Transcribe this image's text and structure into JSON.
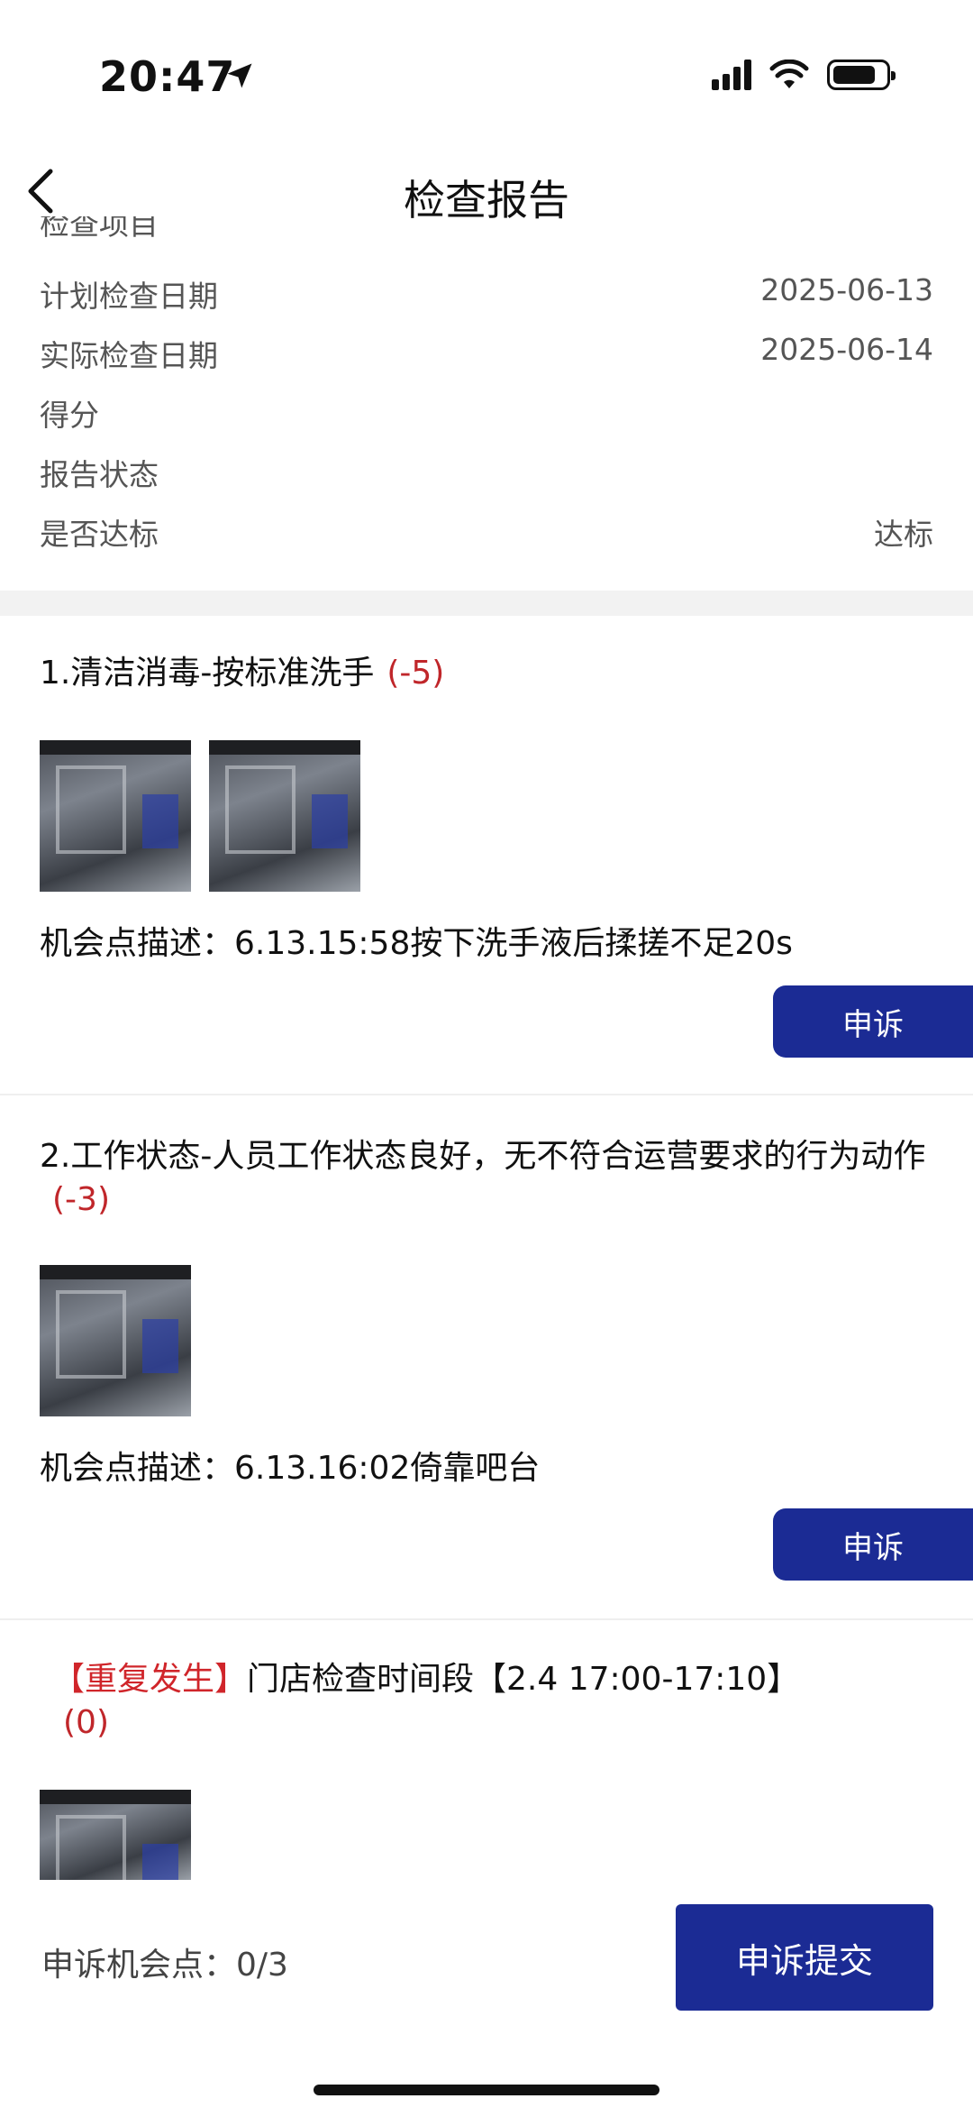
{
  "status_bar": {
    "time": "20:47"
  },
  "nav": {
    "title": "检查报告"
  },
  "info_partial": {
    "label": "检查项目"
  },
  "info": [
    {
      "label": "计划检查日期",
      "value": "2025-06-13"
    },
    {
      "label": "实际检查日期",
      "value": "2025-06-14"
    },
    {
      "label": "得分",
      "value": ""
    },
    {
      "label": "报告状态",
      "value": ""
    },
    {
      "label": "是否达标",
      "value": "达标"
    }
  ],
  "items": [
    {
      "title": "1.清洁消毒-按标准洗手",
      "score": "(-5)",
      "desc": "机会点描述：6.13.15:58按下洗手液后揉搓不足20s",
      "appeal": "申诉"
    },
    {
      "title": "2.工作状态-人员工作状态良好，无不符合运营要求的行为动作",
      "score": "(-3)",
      "desc": "机会点描述：6.13.16:02倚靠吧台",
      "appeal": "申诉"
    },
    {
      "tag": "【重复发生】",
      "title": "门店检查时间段【2.4 17:00-17:10】",
      "score": "(0)"
    }
  ],
  "bottom": {
    "count_label": "申诉机会点：0/3",
    "submit": "申诉提交"
  }
}
